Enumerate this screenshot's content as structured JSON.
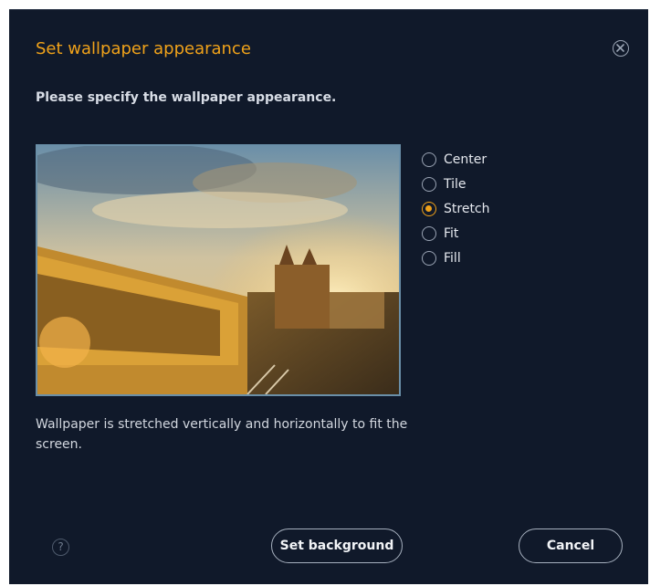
{
  "dialog": {
    "title": "Set wallpaper appearance",
    "instruction": "Please specify the wallpaper appearance.",
    "description": "Wallpaper is stretched vertically and horizontally to fit the screen."
  },
  "options": [
    {
      "label": "Center",
      "selected": false
    },
    {
      "label": "Tile",
      "selected": false
    },
    {
      "label": "Stretch",
      "selected": true
    },
    {
      "label": "Fit",
      "selected": false
    },
    {
      "label": "Fill",
      "selected": false
    }
  ],
  "buttons": {
    "help": "?",
    "set_background": "Set background",
    "cancel": "Cancel"
  },
  "colors": {
    "background": "#10192a",
    "accent": "#f0a21a"
  },
  "icons": {
    "close": "close-circle-icon",
    "help": "help-circle-icon"
  }
}
